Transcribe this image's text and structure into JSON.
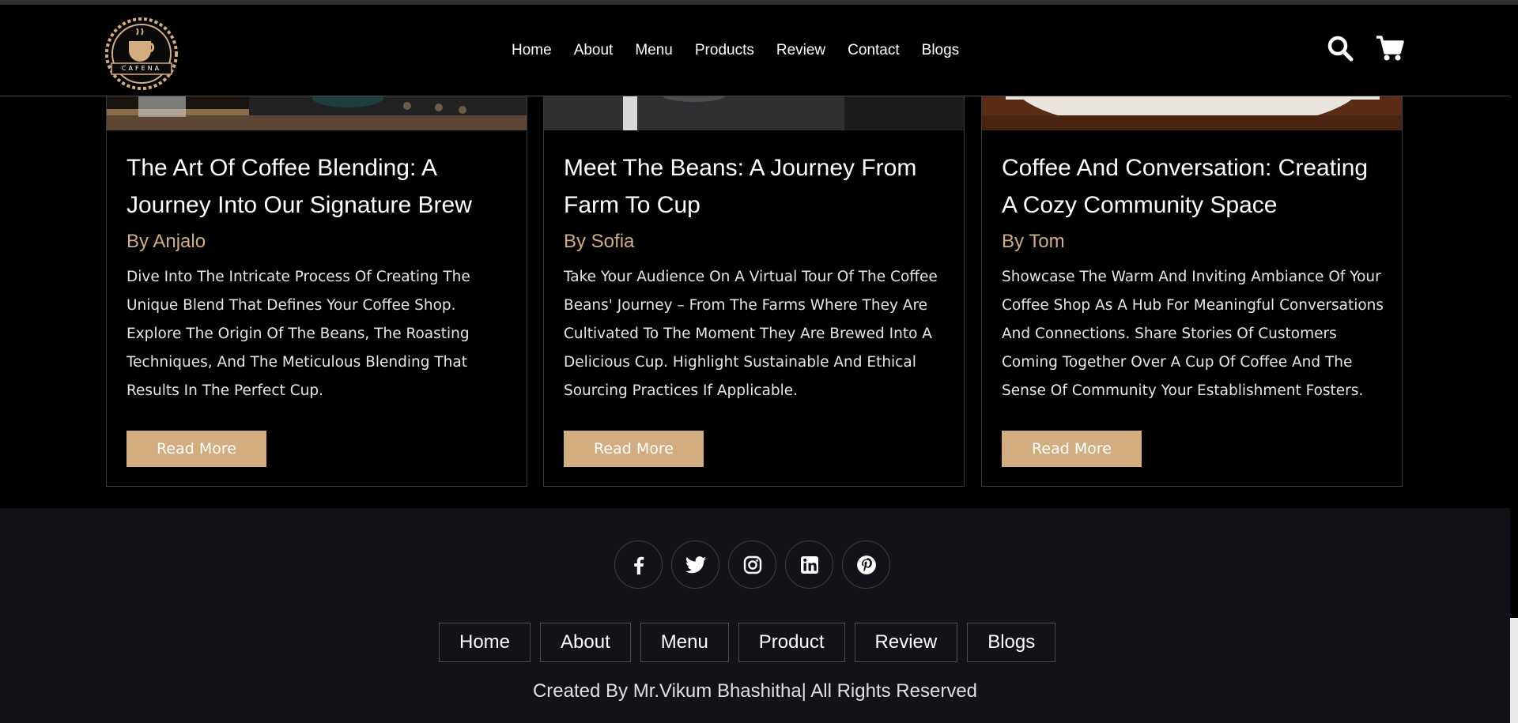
{
  "header": {
    "logo_text": "CAFENA",
    "nav": [
      "Home",
      "About",
      "Menu",
      "Products",
      "Review",
      "Contact",
      "Blogs"
    ],
    "icons": [
      "search-icon",
      "cart-icon"
    ]
  },
  "blogs": [
    {
      "title": "The Art Of Coffee Blending: A Journey Into Our Signature Brew",
      "author": "By Anjalo",
      "text": "Dive Into The Intricate Process Of Creating The Unique Blend That Defines Your Coffee Shop. Explore The Origin Of The Beans, The Roasting Techniques, And The Meticulous Blending That Results In The Perfect Cup.",
      "button": "Read More"
    },
    {
      "title": "Meet The Beans: A Journey From Farm To Cup",
      "author": "By Sofia",
      "text": "Take Your Audience On A Virtual Tour Of The Coffee Beans' Journey – From The Farms Where They Are Cultivated To The Moment They Are Brewed Into A Delicious Cup. Highlight Sustainable And Ethical Sourcing Practices If Applicable.",
      "button": "Read More"
    },
    {
      "title": "Coffee And Conversation: Creating A Cozy Community Space",
      "author": "By Tom",
      "text": "Showcase The Warm And Inviting Ambiance Of Your Coffee Shop As A Hub For Meaningful Conversations And Connections. Share Stories Of Customers Coming Together Over A Cup Of Coffee And The Sense Of Community Your Establishment Fosters.",
      "button": "Read More"
    }
  ],
  "footer": {
    "socials": [
      "facebook-icon",
      "twitter-icon",
      "instagram-icon",
      "linkedin-icon",
      "pinterest-icon"
    ],
    "links": [
      "Home",
      "About",
      "Menu",
      "Product",
      "Review",
      "Blogs"
    ],
    "credit": "Created By Mr.Vikum Bhashitha| All Rights Reserved"
  },
  "colors": {
    "accent": "#d3ad7f",
    "background": "#000000",
    "footer_bg": "#121318",
    "border": "#3a3a3a"
  }
}
